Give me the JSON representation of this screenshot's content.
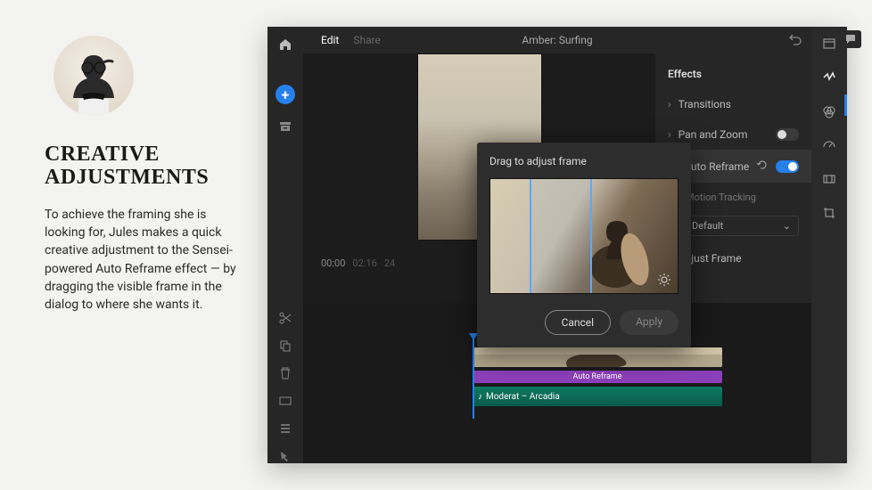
{
  "persona": {
    "title_line1": "CREATIVE",
    "title_line2": "ADJUSTMENTS",
    "body": "To achieve the framing she is looking for, Jules makes a quick creative adjustment to the Sensei-powered Auto Reframe effect — by dragging the visible frame in the dialog to where she wants it."
  },
  "topbar": {
    "tabs": {
      "edit": "Edit",
      "share": "Share"
    },
    "project_title": "Amber: Surfing"
  },
  "timecodes": {
    "current": "00:00",
    "duration": "02:16",
    "fps": "24"
  },
  "timeline": {
    "autoreframe_label": "Auto Reframe",
    "audio_label": "Moderat – Arcadia"
  },
  "effects_panel": {
    "title": "Effects",
    "transitions": "Transitions",
    "pan_zoom": "Pan and Zoom",
    "auto_reframe": "Auto Reframe",
    "motion_tracking": "Motion Tracking",
    "default_label": "Default",
    "adjust_frame": "Adjust Frame"
  },
  "dialog": {
    "title": "Drag to adjust frame",
    "cancel": "Cancel",
    "apply": "Apply"
  }
}
